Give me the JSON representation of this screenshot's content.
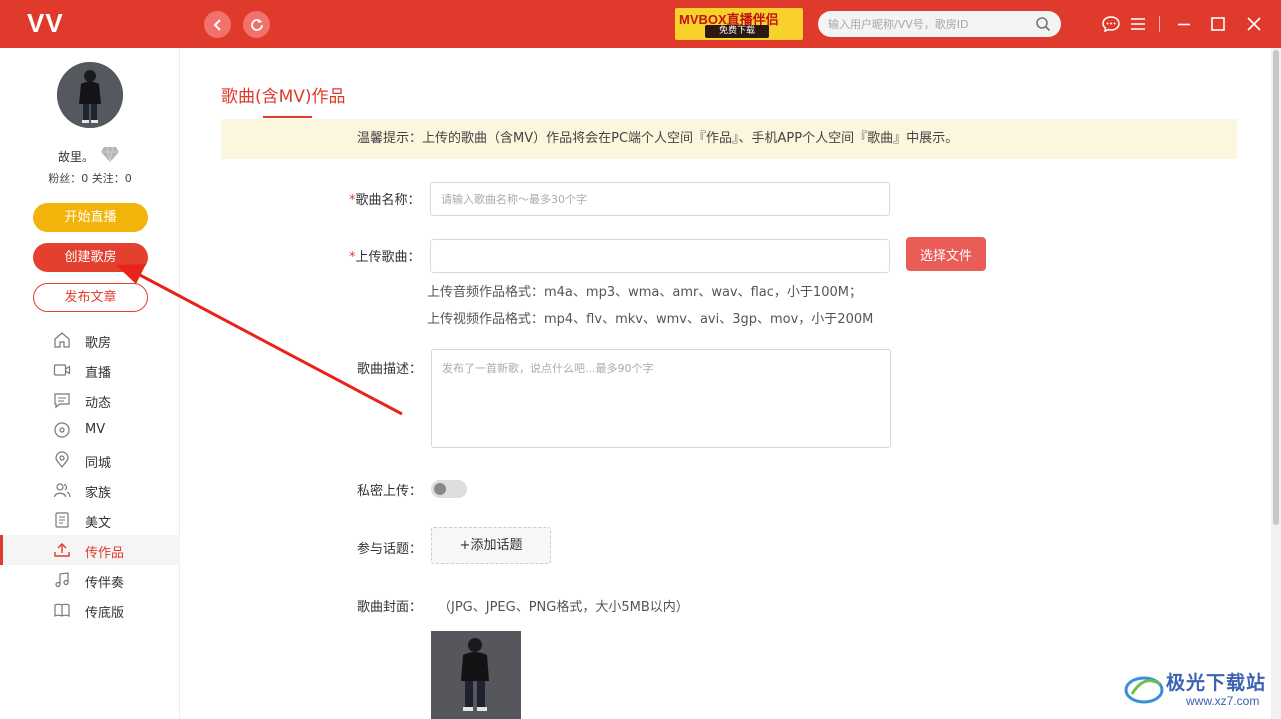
{
  "app": {
    "logo": "VV"
  },
  "topbar": {
    "ad_title": "MVBOX直播伴侣",
    "ad_subtitle": "免费下载",
    "search_placeholder": "输入用户昵称/VV号，歌房ID"
  },
  "user": {
    "name": "故里。",
    "stats": "粉丝：0  关注：0"
  },
  "sidebar": {
    "start_live": "开始直播",
    "create_room": "创建歌房",
    "publish_article": "发布文章",
    "nav": [
      {
        "label": "歌房",
        "icon": "home-icon"
      },
      {
        "label": "直播",
        "icon": "video-icon"
      },
      {
        "label": "动态",
        "icon": "message-icon"
      },
      {
        "label": "MV",
        "icon": "disc-icon"
      },
      {
        "label": "同城",
        "icon": "location-icon"
      },
      {
        "label": "家族",
        "icon": "family-icon"
      },
      {
        "label": "美文",
        "icon": "article-icon"
      },
      {
        "label": "传作品",
        "icon": "upload-icon",
        "active": true
      },
      {
        "label": "传伴奏",
        "icon": "music-note-icon"
      },
      {
        "label": "传底版",
        "icon": "book-icon"
      }
    ]
  },
  "page": {
    "title": "歌曲(含MV)作品",
    "notice": "温馨提示：上传的歌曲（含MV）作品将会在PC端个人空间『作品』、手机APP个人空间『歌曲』中展示。"
  },
  "form": {
    "required_mark": "*",
    "song_name_label": "歌曲名称：",
    "song_name_placeholder": "请输入歌曲名称～最多30个字",
    "upload_label": "上传歌曲：",
    "upload_value": "",
    "choose_file": "选择文件",
    "audio_formats": "上传音频作品格式：m4a、mp3、wma、amr、wav、flac，小于100M；",
    "video_formats": "上传视频作品格式：mp4、flv、mkv、wmv、avi、3gp、mov，小于200M",
    "desc_label": "歌曲描述：",
    "desc_placeholder": "发布了一首新歌，说点什么吧...最多90个字",
    "private_label": "私密上传：",
    "private_enabled": false,
    "topic_label": "参与话题：",
    "add_topic": "+添加话题",
    "cover_label": "歌曲封面：",
    "cover_note": "（JPG、JPEG、PNG格式，大小5MB以内）"
  },
  "watermark": {
    "text": "极光下载站",
    "url": "www.xz7.com"
  },
  "colors": {
    "brand": "#e03a2c",
    "live_button": "#f2b40a",
    "notice_bg": "#fdf6de"
  }
}
